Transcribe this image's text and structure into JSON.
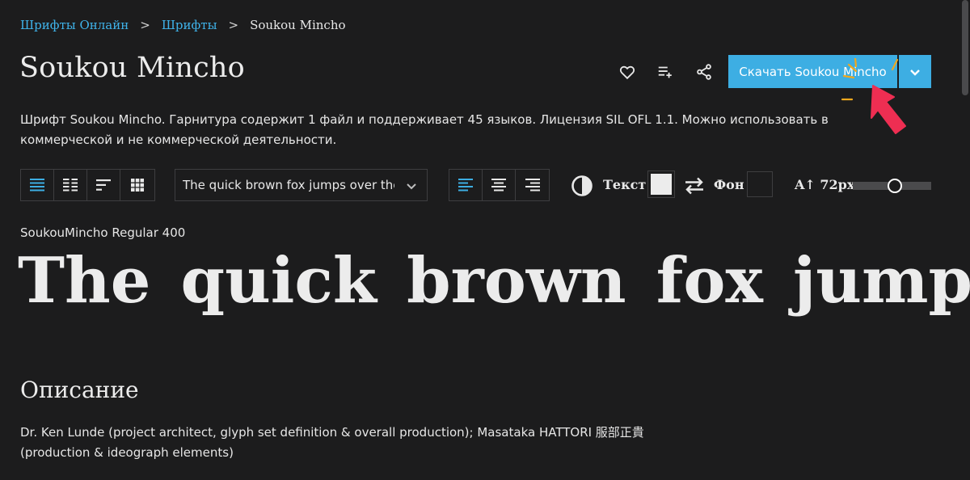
{
  "breadcrumb": {
    "items": [
      "Шрифты Онлайн",
      "Шрифты"
    ],
    "separator": ">",
    "current": "Soukou Mincho"
  },
  "title": "Soukou Mincho",
  "actions": {
    "favorite_icon": "heart-icon",
    "playlist_icon": "playlist-add-icon",
    "share_icon": "share-icon",
    "download_label": "Скачать Soukou Mincho",
    "dropdown_icon": "chevron-down-icon"
  },
  "description": "Шрифт Soukou Mincho. Гарнитура содержит 1 файл и поддерживает 45 языков. Лицензия SIL OFL 1.1. Можно использовать в коммерческой и не коммерческой деятельности.",
  "toolbar": {
    "view_modes": [
      "view-lines-icon",
      "view-columns-icon",
      "view-left-icon",
      "view-grid-icon"
    ],
    "active_view": "view-lines-icon",
    "sample_select_value": "The quick brown fox jumps over the lazy dog",
    "align_modes": [
      "align-left-icon",
      "align-center-icon",
      "align-right-icon"
    ],
    "active_align": "align-left-icon",
    "text_label": "Текст",
    "text_color": "#ececec",
    "bg_label": "Фон",
    "bg_color": "#1c1c1d",
    "size_label": "72px",
    "size_value": 72
  },
  "preview": {
    "style_label": "SoukouMincho Regular 400",
    "sample": "The quick brown fox jumps"
  },
  "section": {
    "title": "Описание",
    "credits": "Dr. Ken Lunde (project architect, glyph set definition & overall production); Masataka HATTORI 服部正貴 (production & ideograph elements)"
  },
  "colors": {
    "background": "#1c1c1d",
    "accent": "#3daee3",
    "link": "#3fb3ea",
    "text": "#e8e8e8",
    "border": "#3e3e40"
  }
}
